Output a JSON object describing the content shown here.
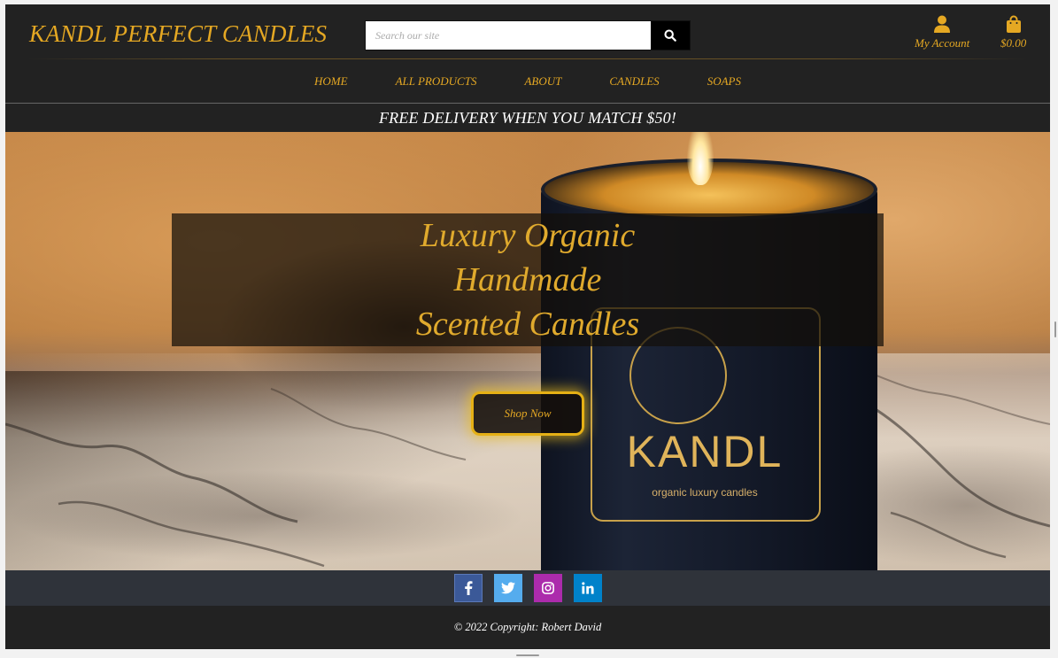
{
  "header": {
    "brand": "KANDL PERFECT CANDLES",
    "search_placeholder": "Search our site",
    "search_value": "",
    "account_label": "My Account",
    "bag_total": "$0.00"
  },
  "nav": {
    "items": [
      {
        "label": "HOME"
      },
      {
        "label": "ALL PRODUCTS"
      },
      {
        "label": "ABOUT"
      },
      {
        "label": "CANDLES"
      },
      {
        "label": "SOAPS"
      }
    ]
  },
  "banner": {
    "text": "FREE DELIVERY WHEN YOU MATCH $50!"
  },
  "hero": {
    "title_lines": [
      "Luxury Organic",
      "Handmade",
      "Scented Candles"
    ],
    "cta_label": "Shop Now",
    "candle_brand": "KANDL",
    "candle_tagline": "organic luxury candles"
  },
  "social": {
    "icons": [
      {
        "name": "facebook-icon",
        "color": "#3b5998"
      },
      {
        "name": "twitter-icon",
        "color": "#55acee"
      },
      {
        "name": "instagram-icon",
        "color": "#ac2bac"
      },
      {
        "name": "linkedin-icon",
        "color": "#0082ca"
      }
    ]
  },
  "footer": {
    "copyright": "© 2022 Copyright: Robert David"
  },
  "colors": {
    "accent": "#e5a823",
    "background": "#222222",
    "social_bar": "#2f333a"
  }
}
